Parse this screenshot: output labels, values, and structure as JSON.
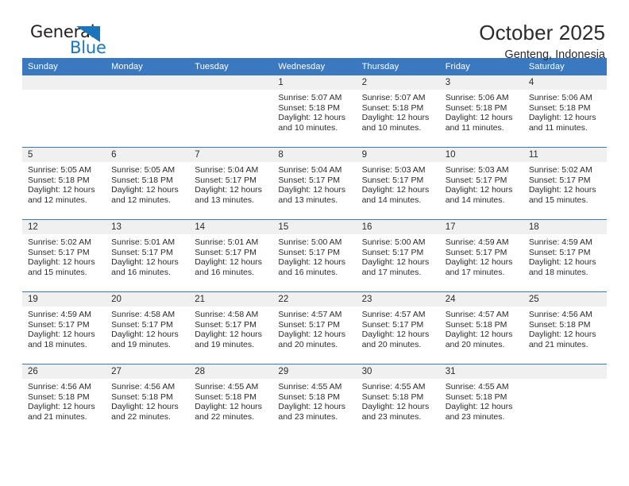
{
  "brand": {
    "word_one": "General",
    "word_two": "Blue",
    "triangle_icon": "triangle-icon",
    "accent_color": "#1b75bc"
  },
  "header": {
    "title": "October 2025",
    "subtitle": "Genteng, Indonesia"
  },
  "calendar": {
    "header_background": "#3a79c0",
    "daynum_background": "#f0f0f0",
    "weekday_headers": [
      "Sunday",
      "Monday",
      "Tuesday",
      "Wednesday",
      "Thursday",
      "Friday",
      "Saturday"
    ],
    "weeks": [
      [
        {
          "day": "",
          "sunrise": "",
          "sunset": "",
          "daylight_line1": "",
          "daylight_line2": "",
          "empty": true
        },
        {
          "day": "",
          "sunrise": "",
          "sunset": "",
          "daylight_line1": "",
          "daylight_line2": "",
          "empty": true
        },
        {
          "day": "",
          "sunrise": "",
          "sunset": "",
          "daylight_line1": "",
          "daylight_line2": "",
          "empty": true
        },
        {
          "day": "1",
          "sunrise": "Sunrise: 5:07 AM",
          "sunset": "Sunset: 5:18 PM",
          "daylight_line1": "Daylight: 12 hours",
          "daylight_line2": "and 10 minutes.",
          "empty": false
        },
        {
          "day": "2",
          "sunrise": "Sunrise: 5:07 AM",
          "sunset": "Sunset: 5:18 PM",
          "daylight_line1": "Daylight: 12 hours",
          "daylight_line2": "and 10 minutes.",
          "empty": false
        },
        {
          "day": "3",
          "sunrise": "Sunrise: 5:06 AM",
          "sunset": "Sunset: 5:18 PM",
          "daylight_line1": "Daylight: 12 hours",
          "daylight_line2": "and 11 minutes.",
          "empty": false
        },
        {
          "day": "4",
          "sunrise": "Sunrise: 5:06 AM",
          "sunset": "Sunset: 5:18 PM",
          "daylight_line1": "Daylight: 12 hours",
          "daylight_line2": "and 11 minutes.",
          "empty": false
        }
      ],
      [
        {
          "day": "5",
          "sunrise": "Sunrise: 5:05 AM",
          "sunset": "Sunset: 5:18 PM",
          "daylight_line1": "Daylight: 12 hours",
          "daylight_line2": "and 12 minutes.",
          "empty": false
        },
        {
          "day": "6",
          "sunrise": "Sunrise: 5:05 AM",
          "sunset": "Sunset: 5:18 PM",
          "daylight_line1": "Daylight: 12 hours",
          "daylight_line2": "and 12 minutes.",
          "empty": false
        },
        {
          "day": "7",
          "sunrise": "Sunrise: 5:04 AM",
          "sunset": "Sunset: 5:17 PM",
          "daylight_line1": "Daylight: 12 hours",
          "daylight_line2": "and 13 minutes.",
          "empty": false
        },
        {
          "day": "8",
          "sunrise": "Sunrise: 5:04 AM",
          "sunset": "Sunset: 5:17 PM",
          "daylight_line1": "Daylight: 12 hours",
          "daylight_line2": "and 13 minutes.",
          "empty": false
        },
        {
          "day": "9",
          "sunrise": "Sunrise: 5:03 AM",
          "sunset": "Sunset: 5:17 PM",
          "daylight_line1": "Daylight: 12 hours",
          "daylight_line2": "and 14 minutes.",
          "empty": false
        },
        {
          "day": "10",
          "sunrise": "Sunrise: 5:03 AM",
          "sunset": "Sunset: 5:17 PM",
          "daylight_line1": "Daylight: 12 hours",
          "daylight_line2": "and 14 minutes.",
          "empty": false
        },
        {
          "day": "11",
          "sunrise": "Sunrise: 5:02 AM",
          "sunset": "Sunset: 5:17 PM",
          "daylight_line1": "Daylight: 12 hours",
          "daylight_line2": "and 15 minutes.",
          "empty": false
        }
      ],
      [
        {
          "day": "12",
          "sunrise": "Sunrise: 5:02 AM",
          "sunset": "Sunset: 5:17 PM",
          "daylight_line1": "Daylight: 12 hours",
          "daylight_line2": "and 15 minutes.",
          "empty": false
        },
        {
          "day": "13",
          "sunrise": "Sunrise: 5:01 AM",
          "sunset": "Sunset: 5:17 PM",
          "daylight_line1": "Daylight: 12 hours",
          "daylight_line2": "and 16 minutes.",
          "empty": false
        },
        {
          "day": "14",
          "sunrise": "Sunrise: 5:01 AM",
          "sunset": "Sunset: 5:17 PM",
          "daylight_line1": "Daylight: 12 hours",
          "daylight_line2": "and 16 minutes.",
          "empty": false
        },
        {
          "day": "15",
          "sunrise": "Sunrise: 5:00 AM",
          "sunset": "Sunset: 5:17 PM",
          "daylight_line1": "Daylight: 12 hours",
          "daylight_line2": "and 16 minutes.",
          "empty": false
        },
        {
          "day": "16",
          "sunrise": "Sunrise: 5:00 AM",
          "sunset": "Sunset: 5:17 PM",
          "daylight_line1": "Daylight: 12 hours",
          "daylight_line2": "and 17 minutes.",
          "empty": false
        },
        {
          "day": "17",
          "sunrise": "Sunrise: 4:59 AM",
          "sunset": "Sunset: 5:17 PM",
          "daylight_line1": "Daylight: 12 hours",
          "daylight_line2": "and 17 minutes.",
          "empty": false
        },
        {
          "day": "18",
          "sunrise": "Sunrise: 4:59 AM",
          "sunset": "Sunset: 5:17 PM",
          "daylight_line1": "Daylight: 12 hours",
          "daylight_line2": "and 18 minutes.",
          "empty": false
        }
      ],
      [
        {
          "day": "19",
          "sunrise": "Sunrise: 4:59 AM",
          "sunset": "Sunset: 5:17 PM",
          "daylight_line1": "Daylight: 12 hours",
          "daylight_line2": "and 18 minutes.",
          "empty": false
        },
        {
          "day": "20",
          "sunrise": "Sunrise: 4:58 AM",
          "sunset": "Sunset: 5:17 PM",
          "daylight_line1": "Daylight: 12 hours",
          "daylight_line2": "and 19 minutes.",
          "empty": false
        },
        {
          "day": "21",
          "sunrise": "Sunrise: 4:58 AM",
          "sunset": "Sunset: 5:17 PM",
          "daylight_line1": "Daylight: 12 hours",
          "daylight_line2": "and 19 minutes.",
          "empty": false
        },
        {
          "day": "22",
          "sunrise": "Sunrise: 4:57 AM",
          "sunset": "Sunset: 5:17 PM",
          "daylight_line1": "Daylight: 12 hours",
          "daylight_line2": "and 20 minutes.",
          "empty": false
        },
        {
          "day": "23",
          "sunrise": "Sunrise: 4:57 AM",
          "sunset": "Sunset: 5:17 PM",
          "daylight_line1": "Daylight: 12 hours",
          "daylight_line2": "and 20 minutes.",
          "empty": false
        },
        {
          "day": "24",
          "sunrise": "Sunrise: 4:57 AM",
          "sunset": "Sunset: 5:18 PM",
          "daylight_line1": "Daylight: 12 hours",
          "daylight_line2": "and 20 minutes.",
          "empty": false
        },
        {
          "day": "25",
          "sunrise": "Sunrise: 4:56 AM",
          "sunset": "Sunset: 5:18 PM",
          "daylight_line1": "Daylight: 12 hours",
          "daylight_line2": "and 21 minutes.",
          "empty": false
        }
      ],
      [
        {
          "day": "26",
          "sunrise": "Sunrise: 4:56 AM",
          "sunset": "Sunset: 5:18 PM",
          "daylight_line1": "Daylight: 12 hours",
          "daylight_line2": "and 21 minutes.",
          "empty": false
        },
        {
          "day": "27",
          "sunrise": "Sunrise: 4:56 AM",
          "sunset": "Sunset: 5:18 PM",
          "daylight_line1": "Daylight: 12 hours",
          "daylight_line2": "and 22 minutes.",
          "empty": false
        },
        {
          "day": "28",
          "sunrise": "Sunrise: 4:55 AM",
          "sunset": "Sunset: 5:18 PM",
          "daylight_line1": "Daylight: 12 hours",
          "daylight_line2": "and 22 minutes.",
          "empty": false
        },
        {
          "day": "29",
          "sunrise": "Sunrise: 4:55 AM",
          "sunset": "Sunset: 5:18 PM",
          "daylight_line1": "Daylight: 12 hours",
          "daylight_line2": "and 23 minutes.",
          "empty": false
        },
        {
          "day": "30",
          "sunrise": "Sunrise: 4:55 AM",
          "sunset": "Sunset: 5:18 PM",
          "daylight_line1": "Daylight: 12 hours",
          "daylight_line2": "and 23 minutes.",
          "empty": false
        },
        {
          "day": "31",
          "sunrise": "Sunrise: 4:55 AM",
          "sunset": "Sunset: 5:18 PM",
          "daylight_line1": "Daylight: 12 hours",
          "daylight_line2": "and 23 minutes.",
          "empty": false
        },
        {
          "day": "",
          "sunrise": "",
          "sunset": "",
          "daylight_line1": "",
          "daylight_line2": "",
          "empty": true
        }
      ]
    ]
  }
}
